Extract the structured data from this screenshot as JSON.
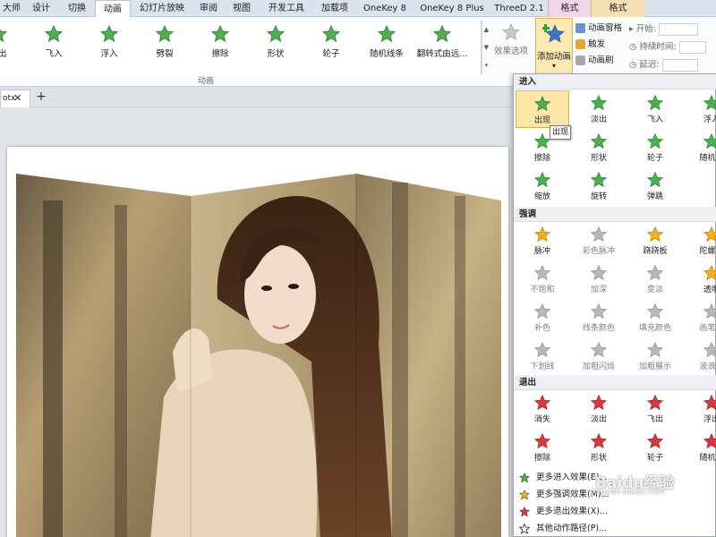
{
  "tabs": [
    "大师",
    "设计",
    "切换",
    "动画",
    "幻灯片放映",
    "审阅",
    "视图",
    "开发工具",
    "加载项",
    "OneKey 8",
    "OneKey 8 Plus",
    "ThreeD 2.1",
    "格式",
    "格式"
  ],
  "active_tab": "动画",
  "gallery": [
    {
      "label": "淡出",
      "color": "green"
    },
    {
      "label": "飞入",
      "color": "green"
    },
    {
      "label": "浮入",
      "color": "green"
    },
    {
      "label": "劈裂",
      "color": "green"
    },
    {
      "label": "擦除",
      "color": "green"
    },
    {
      "label": "形状",
      "color": "green"
    },
    {
      "label": "轮子",
      "color": "green"
    },
    {
      "label": "随机线条",
      "color": "green"
    },
    {
      "label": "翻转式由远...",
      "color": "green"
    }
  ],
  "effect_options": "效果选项",
  "add_animation": "添加动画",
  "side_buttons": [
    "动画窗格",
    "触发",
    "动画刷"
  ],
  "timing": {
    "start": "开始:",
    "duration": "持续时间:",
    "delay": "延迟:"
  },
  "group_label": "动画",
  "doc_tab": "otx",
  "dropdown": {
    "sections": [
      "进入",
      "强调",
      "退出"
    ],
    "entrance": [
      {
        "label": "出现",
        "color": "green"
      },
      {
        "label": "淡出",
        "color": "green"
      },
      {
        "label": "飞入",
        "color": "green"
      },
      {
        "label": "浮入",
        "color": "green"
      },
      {
        "label": "擦除",
        "color": "green"
      },
      {
        "label": "形状",
        "color": "green"
      },
      {
        "label": "轮子",
        "color": "green"
      },
      {
        "label": "随机线",
        "color": "green"
      },
      {
        "label": "缩放",
        "color": "green"
      },
      {
        "label": "旋转",
        "color": "green"
      },
      {
        "label": "弹跳",
        "color": "green"
      }
    ],
    "emphasis": [
      {
        "label": "脉冲",
        "color": "gold"
      },
      {
        "label": "彩色脉冲",
        "color": "gray"
      },
      {
        "label": "跷跷板",
        "color": "gold"
      },
      {
        "label": "陀螺旋",
        "color": "gold"
      },
      {
        "label": "不饱和",
        "color": "gray"
      },
      {
        "label": "加深",
        "color": "gray"
      },
      {
        "label": "变淡",
        "color": "gray"
      },
      {
        "label": "透明",
        "color": "gold"
      },
      {
        "label": "补色",
        "color": "gray"
      },
      {
        "label": "线条颜色",
        "color": "gray"
      },
      {
        "label": "填充颜色",
        "color": "gray"
      },
      {
        "label": "画笔颜",
        "color": "gray"
      },
      {
        "label": "下划线",
        "color": "gray"
      },
      {
        "label": "加粗闪烁",
        "color": "gray"
      },
      {
        "label": "加粗展示",
        "color": "gray"
      },
      {
        "label": "波浪形",
        "color": "gray"
      }
    ],
    "exit": [
      {
        "label": "消失",
        "color": "red"
      },
      {
        "label": "淡出",
        "color": "red"
      },
      {
        "label": "飞出",
        "color": "red"
      },
      {
        "label": "浮出",
        "color": "red"
      },
      {
        "label": "擦除",
        "color": "red"
      },
      {
        "label": "形状",
        "color": "red"
      },
      {
        "label": "轮子",
        "color": "red"
      },
      {
        "label": "随机线",
        "color": "red"
      }
    ],
    "more": [
      "更多进入效果(E)...",
      "更多强调效果(M)...",
      "更多退出效果(X)...",
      "其他动作路径(P)..."
    ],
    "tooltip": "出现",
    "selected": "出现"
  },
  "watermark": {
    "brand": "Baidu经验",
    "url": "jingyan.baidu.com"
  },
  "colors": {
    "green": "#4caf50",
    "gold": "#f2b01e",
    "gray": "#b8b8b8",
    "red": "#d9363e",
    "accent": "#fce8b0"
  }
}
